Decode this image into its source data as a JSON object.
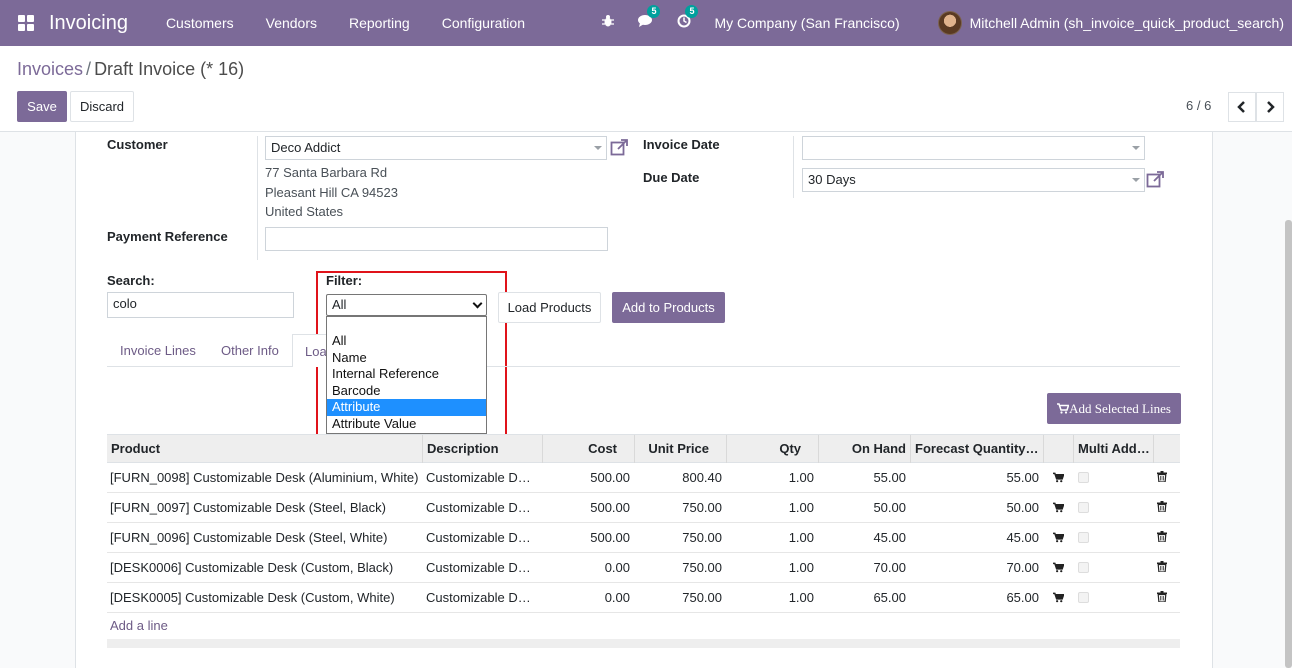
{
  "navbar": {
    "brand": "Invoicing",
    "menu": [
      "Customers",
      "Vendors",
      "Reporting",
      "Configuration"
    ],
    "chat_badge": "5",
    "activity_badge": "5",
    "company": "My Company (San Francisco)",
    "user": "Mitchell Admin (sh_invoice_quick_product_search)"
  },
  "control": {
    "breadcrumb_parent": "Invoices",
    "breadcrumb_separator": "/",
    "breadcrumb_current": "Draft Invoice (* 16)",
    "save_label": "Save",
    "discard_label": "Discard",
    "pager": "6 / 6"
  },
  "form": {
    "customer_label": "Customer",
    "customer_value": "Deco Addict",
    "address": [
      "77 Santa Barbara Rd",
      "Pleasant Hill CA 94523",
      "United States"
    ],
    "payment_ref_label": "Payment Reference",
    "payment_ref_value": "",
    "invoice_date_label": "Invoice Date",
    "invoice_date_value": "",
    "due_date_label": "Due Date",
    "due_date_value": "30 Days"
  },
  "search": {
    "label": "Search:",
    "value": "colo",
    "filter_label": "Filter:",
    "filter_value": "All",
    "filter_options": [
      "All",
      "Name",
      "Internal Reference",
      "Barcode",
      "Attribute",
      "Attribute Value"
    ],
    "filter_highlighted": "Attribute",
    "load_products_label": "Load Products",
    "add_to_products_label": "Add to Products"
  },
  "tabs": [
    "Invoice Lines",
    "Other Info",
    "Load Products"
  ],
  "active_tab_visible_text": "Loa",
  "add_selected_label": "Add Selected Lines",
  "table": {
    "headers": [
      "Product",
      "Description",
      "Cost",
      "Unit Price",
      "Qty",
      "On Hand",
      "Forecast Quantity…",
      "Multi Add…"
    ],
    "rows": [
      {
        "product": "[FURN_0098] Customizable Desk (Aluminium, White)",
        "description": "Customizable D…",
        "cost": "500.00",
        "unit_price": "800.40",
        "qty": "1.00",
        "on_hand": "55.00",
        "forecast": "55.00"
      },
      {
        "product": "[FURN_0097] Customizable Desk (Steel, Black)",
        "description": "Customizable D…",
        "cost": "500.00",
        "unit_price": "750.00",
        "qty": "1.00",
        "on_hand": "50.00",
        "forecast": "50.00"
      },
      {
        "product": "[FURN_0096] Customizable Desk (Steel, White)",
        "description": "Customizable D…",
        "cost": "500.00",
        "unit_price": "750.00",
        "qty": "1.00",
        "on_hand": "45.00",
        "forecast": "45.00"
      },
      {
        "product": "[DESK0006] Customizable Desk (Custom, Black)",
        "description": "Customizable D…",
        "cost": "0.00",
        "unit_price": "750.00",
        "qty": "1.00",
        "on_hand": "70.00",
        "forecast": "70.00"
      },
      {
        "product": "[DESK0005] Customizable Desk (Custom, White)",
        "description": "Customizable D…",
        "cost": "0.00",
        "unit_price": "750.00",
        "qty": "1.00",
        "on_hand": "65.00",
        "forecast": "65.00"
      }
    ],
    "add_line_label": "Add a line"
  },
  "colors": {
    "brand": "#7c6a98",
    "highlight": "#1e90ff",
    "annotation": "#e0131a"
  },
  "icons": [
    "apps-icon",
    "bug-icon",
    "chat-icon",
    "activity-icon",
    "external-link-icon",
    "chevron-left-icon",
    "chevron-right-icon",
    "cart-icon",
    "trash-icon"
  ]
}
